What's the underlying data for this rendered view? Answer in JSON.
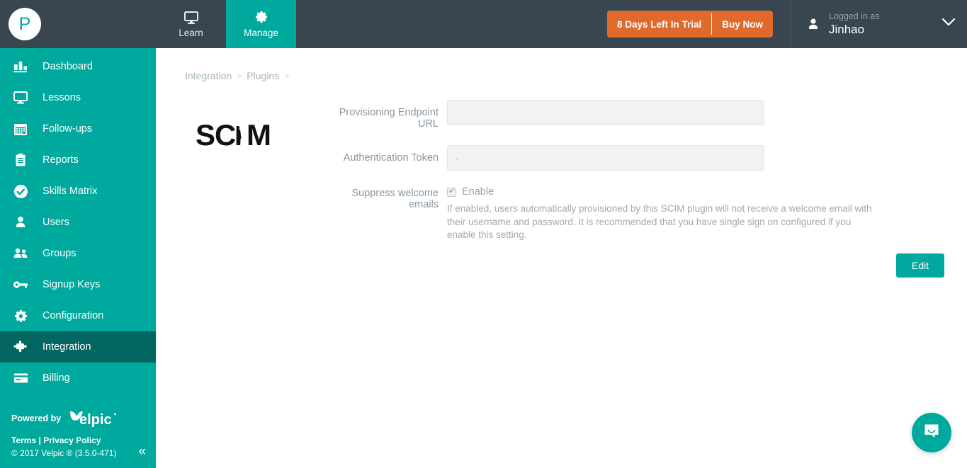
{
  "header": {
    "avatar_initial": "P",
    "tabs": [
      {
        "label": "Learn",
        "icon": "monitor-icon",
        "active": false
      },
      {
        "label": "Manage",
        "icon": "gear-icon",
        "active": true
      }
    ],
    "trial": {
      "days_label": "8 Days Left In Trial",
      "buy_label": "Buy Now",
      "color": "#e2692c"
    },
    "user": {
      "logged_in_label": "Logged in as",
      "name": "Jinhao"
    }
  },
  "sidebar": {
    "accent": "#00a99d",
    "active_color": "#036660",
    "items": [
      {
        "label": "Dashboard",
        "icon": "bar-chart-icon"
      },
      {
        "label": "Lessons",
        "icon": "monitor-icon"
      },
      {
        "label": "Follow-ups",
        "icon": "calendar-icon"
      },
      {
        "label": "Reports",
        "icon": "clipboard-icon"
      },
      {
        "label": "Skills Matrix",
        "icon": "check-circle-icon"
      },
      {
        "label": "Users",
        "icon": "user-icon"
      },
      {
        "label": "Groups",
        "icon": "users-icon"
      },
      {
        "label": "Signup Keys",
        "icon": "key-icon"
      },
      {
        "label": "Configuration",
        "icon": "gear-icon"
      },
      {
        "label": "Integration",
        "icon": "puzzle-icon"
      },
      {
        "label": "Billing",
        "icon": "credit-card-icon"
      }
    ],
    "active_item": "Integration",
    "footer": {
      "powered_by": "Powered by",
      "brand": "velpic",
      "terms": "Terms",
      "separator": "|",
      "privacy": "Privacy Policy",
      "copyright": "© 2017 Velpic ® (3.5.0-471)",
      "collapse_icon": "«"
    }
  },
  "main": {
    "breadcrumb": [
      {
        "label": "Integration"
      },
      {
        "label": "Plugins"
      }
    ],
    "breadcrumb_separator": ">",
    "plugin_logo": "SCIM",
    "form": {
      "endpoint": {
        "label": "Provisioning Endpoint URL",
        "value": "",
        "placeholder": ""
      },
      "token": {
        "label": "Authentication Token",
        "value": "·",
        "placeholder": ""
      },
      "suppress": {
        "label": "Suppress welcome emails",
        "checkbox_label": "Enable",
        "checked": true,
        "help_text": "If enabled, users automatically provisioned by this SCIM plugin will not receive a welcome email with their username and password. It is recommended that you have single sign on configured if you enable this setting."
      }
    },
    "edit_button": "Edit"
  },
  "chat": {
    "icon": "chat-bubble-icon",
    "color": "#00a99d"
  }
}
